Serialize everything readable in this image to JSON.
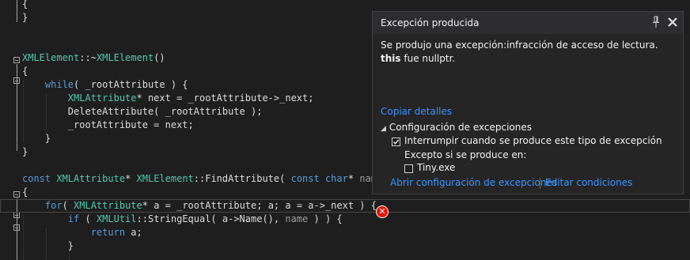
{
  "editor": {
    "lines": [
      {
        "tokens": [
          {
            "t": "{",
            "c": ""
          }
        ]
      },
      {
        "tokens": [
          {
            "t": "}",
            "c": ""
          }
        ]
      },
      {
        "tokens": []
      },
      {
        "tokens": []
      },
      {
        "tokens": [
          {
            "t": "XMLElement",
            "c": "ty"
          },
          {
            "t": "::~",
            "c": ""
          },
          {
            "t": "XMLElement",
            "c": "ty"
          },
          {
            "t": "()",
            "c": ""
          }
        ]
      },
      {
        "tokens": [
          {
            "t": "{",
            "c": ""
          }
        ]
      },
      {
        "tokens": [
          {
            "t": "    ",
            "c": ""
          },
          {
            "t": "while",
            "c": "kw"
          },
          {
            "t": "( _rootAttribute ) {",
            "c": ""
          }
        ]
      },
      {
        "tokens": [
          {
            "t": "        ",
            "c": ""
          },
          {
            "t": "XMLAttribute",
            "c": "ty"
          },
          {
            "t": "* next = _rootAttribute->_next;",
            "c": ""
          }
        ]
      },
      {
        "tokens": [
          {
            "t": "        DeleteAttribute( _rootAttribute );",
            "c": ""
          }
        ]
      },
      {
        "tokens": [
          {
            "t": "        _rootAttribute = next;",
            "c": ""
          }
        ]
      },
      {
        "tokens": [
          {
            "t": "    }",
            "c": ""
          }
        ]
      },
      {
        "tokens": [
          {
            "t": "}",
            "c": ""
          }
        ]
      },
      {
        "tokens": []
      },
      {
        "tokens": [
          {
            "t": "const",
            "c": "kw"
          },
          {
            "t": " ",
            "c": ""
          },
          {
            "t": "XMLAttribute",
            "c": "ty"
          },
          {
            "t": "* ",
            "c": ""
          },
          {
            "t": "XMLElement",
            "c": "ty"
          },
          {
            "t": "::FindAttribute( ",
            "c": ""
          },
          {
            "t": "const",
            "c": "kw"
          },
          {
            "t": " ",
            "c": ""
          },
          {
            "t": "char",
            "c": "kw"
          },
          {
            "t": "* ",
            "c": ""
          },
          {
            "t": "name",
            "c": "pa"
          }
        ]
      },
      {
        "tokens": [
          {
            "t": "{",
            "c": ""
          }
        ]
      },
      {
        "tokens": [
          {
            "t": "    ",
            "c": ""
          },
          {
            "t": "for",
            "c": "kw"
          },
          {
            "t": "( ",
            "c": ""
          },
          {
            "t": "XMLAttribute",
            "c": "ty"
          },
          {
            "t": "* a = _rootAttribute; a; a = a->_next ) {",
            "c": ""
          }
        ]
      },
      {
        "tokens": [
          {
            "t": "        ",
            "c": ""
          },
          {
            "t": "if",
            "c": "kw"
          },
          {
            "t": " ( ",
            "c": ""
          },
          {
            "t": "XMLUtil",
            "c": "ty"
          },
          {
            "t": "::StringEqual( a->Name(), ",
            "c": ""
          },
          {
            "t": "name",
            "c": "pa"
          },
          {
            "t": " ) ) {",
            "c": ""
          }
        ]
      },
      {
        "tokens": [
          {
            "t": "            ",
            "c": ""
          },
          {
            "t": "return",
            "c": "kw"
          },
          {
            "t": " a;",
            "c": ""
          }
        ]
      },
      {
        "tokens": [
          {
            "t": "        }",
            "c": ""
          }
        ]
      }
    ]
  },
  "popup": {
    "title": "Excepción producida",
    "message_line1": "Se produjo una excepción:infracción de acceso de lectura.",
    "message_bold": "this",
    "message_rest": " fue nullptr.",
    "copy_details": "Copiar detalles",
    "settings_heading": "Configuración de excepciones",
    "break_option": "Interrumpir cuando se produce este tipo de excepción",
    "break_checked": true,
    "except_label": "Excepto si se produce en:",
    "module_option": "Tiny.exe",
    "module_checked": false,
    "open_settings_link": "Abrir configuración de excepciones",
    "edit_conditions_link": "Editar condiciones"
  },
  "colors": {
    "background": "#1e1e1e",
    "keyword": "#569cd6",
    "type": "#4ec9b0",
    "parameter": "#9a9a9a",
    "link": "#3794ff",
    "error": "#e51400"
  },
  "icons": {
    "pin": "pin-icon",
    "close": "close-icon",
    "error_glyph": "error-x-icon"
  }
}
